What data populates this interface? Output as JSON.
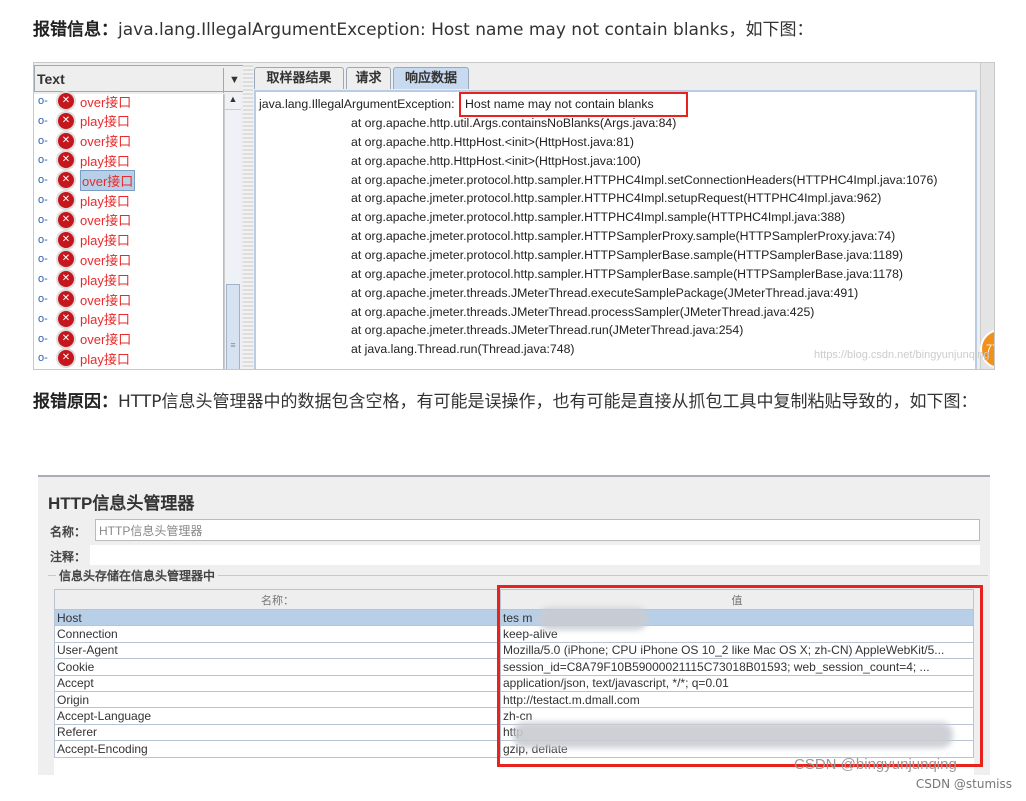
{
  "para1": {
    "label": "报错信息：",
    "text": "java.lang.IllegalArgumentException: Host name may not contain blanks，如下图："
  },
  "shot1": {
    "combo_value": "Text",
    "tree_items": [
      "over接口",
      "play接口",
      "over接口",
      "play接口",
      "over接口",
      "play接口",
      "over接口",
      "play接口",
      "over接口",
      "play接口",
      "over接口",
      "play接口",
      "over接口",
      "play接口"
    ],
    "selected_index": 4,
    "tabs": [
      "取样器结果",
      "请求",
      "响应数据"
    ],
    "active_tab": 2,
    "exception": "java.lang.IllegalArgumentException:",
    "highlight": "Host name may not contain blanks",
    "stack": [
      "at org.apache.http.util.Args.containsNoBlanks(Args.java:84)",
      "at org.apache.http.HttpHost.<init>(HttpHost.java:81)",
      "at org.apache.http.HttpHost.<init>(HttpHost.java:100)",
      "at org.apache.jmeter.protocol.http.sampler.HTTPHC4Impl.setConnectionHeaders(HTTPHC4Impl.java:1076)",
      "at org.apache.jmeter.protocol.http.sampler.HTTPHC4Impl.setupRequest(HTTPHC4Impl.java:962)",
      "at org.apache.jmeter.protocol.http.sampler.HTTPHC4Impl.sample(HTTPHC4Impl.java:388)",
      "at org.apache.jmeter.protocol.http.sampler.HTTPSamplerProxy.sample(HTTPSamplerProxy.java:74)",
      "at org.apache.jmeter.protocol.http.sampler.HTTPSamplerBase.sample(HTTPSamplerBase.java:1189)",
      "at org.apache.jmeter.protocol.http.sampler.HTTPSamplerBase.sample(HTTPSamplerBase.java:1178)",
      "at org.apache.jmeter.threads.JMeterThread.executeSamplePackage(JMeterThread.java:491)",
      "at org.apache.jmeter.threads.JMeterThread.processSampler(JMeterThread.java:425)",
      "at org.apache.jmeter.threads.JMeterThread.run(JMeterThread.java:254)",
      "at java.lang.Thread.run(Thread.java:748)"
    ],
    "badge": "77",
    "watermark": "https://blog.csdn.net/bingyunjunqing"
  },
  "para2": {
    "label": "报错原因：",
    "text": "HTTP信息头管理器中的数据包含空格，有可能是误操作，也有可能是直接从抓包工具中复制粘贴导致的，如下图："
  },
  "shot2": {
    "title": "HTTP信息头管理器",
    "name_label": "名称：",
    "name_value": "HTTP信息头管理器",
    "comment_label": "注释：",
    "fieldset_label": "信息头存储在信息头管理器中",
    "columns": [
      "名称：",
      "值"
    ],
    "rows": [
      [
        "Host",
        "tes                    m"
      ],
      [
        "Connection",
        "keep-alive"
      ],
      [
        "User-Agent",
        "Mozilla/5.0 (iPhone; CPU iPhone OS 10_2 like Mac OS X; zh-CN) AppleWebKit/5..."
      ],
      [
        "Cookie",
        "session_id=C8A79F10B59000021115C73018B01593; web_session_count=4; ..."
      ],
      [
        "Accept",
        "application/json, text/javascript, */*; q=0.01"
      ],
      [
        "Origin",
        "http://testact.m.dmall.com"
      ],
      [
        "Accept-Language",
        "zh-cn"
      ],
      [
        "Referer",
        "http"
      ],
      [
        "Accept-Encoding",
        "gzip, deflate"
      ]
    ],
    "watermark": "CSDN @bingyunjunqing"
  },
  "footer": "CSDN @stumiss",
  "colors": {
    "highlight_box": "#e8231e",
    "error_text": "#e82a2a",
    "selection": "#b8cfe8"
  }
}
